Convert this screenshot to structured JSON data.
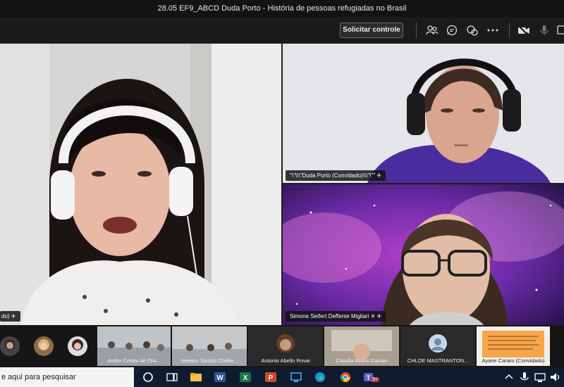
{
  "window": {
    "title": "28.05 EF9_ABCD Duda Porto - História de pessoas refugiadas no Brasil"
  },
  "toolbar": {
    "request_control_label": "Solicitar controle",
    "icons": [
      "participants-icon",
      "chat-icon",
      "reactions-icon",
      "more-icon",
      "camera-off-icon",
      "mic-off-icon",
      "share-icon"
    ]
  },
  "tiles": {
    "main_speaker": {
      "name_suffix": "do)"
    },
    "top_right": {
      "name": "\"\\\"\\\\\\\"Duda Porto (Convidado)\\\\\\\"\\\"\""
    },
    "bottom_right": {
      "name": "Simone Seifert Deffente Migliari"
    }
  },
  "strip": {
    "thumbnails": [
      {
        "name": "Andre Cortes de Oliv..."
      },
      {
        "name": "Newton Santos Chebe..."
      },
      {
        "name": "Antonio Abello Rovai"
      },
      {
        "name": "Claudia Bruno Galvan"
      },
      {
        "name": "CHLOE MASTRANTON..."
      },
      {
        "name": "Ayane Cararo (Convidado)"
      }
    ]
  },
  "taskbar": {
    "search_placeholder": "e aqui para pesquisar",
    "teams_badge": "9+"
  }
}
